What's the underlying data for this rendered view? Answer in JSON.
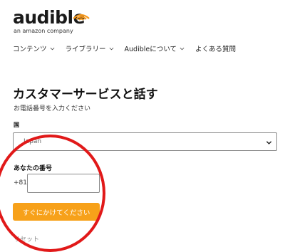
{
  "logo": {
    "wordmark": "audible",
    "tagline": "an amazon company",
    "color_accent": "#f7991c"
  },
  "nav": {
    "items": [
      {
        "label": "コンテンツ"
      },
      {
        "label": "ライブラリー"
      },
      {
        "label": "Audibleについて"
      },
      {
        "label": "よくある質問"
      }
    ]
  },
  "page": {
    "title": "カスタマーサービスと話す",
    "subtitle": "お電話番号を入力ください"
  },
  "form": {
    "country_label": "国",
    "country_value": "Japan",
    "number_label": "あなたの番号",
    "country_code": "+81",
    "number_value": "",
    "call_button": "すぐにかけてください",
    "reset_label": "リセット"
  },
  "colors": {
    "button": "#f7a11a",
    "annotation_circle": "#e11919"
  }
}
